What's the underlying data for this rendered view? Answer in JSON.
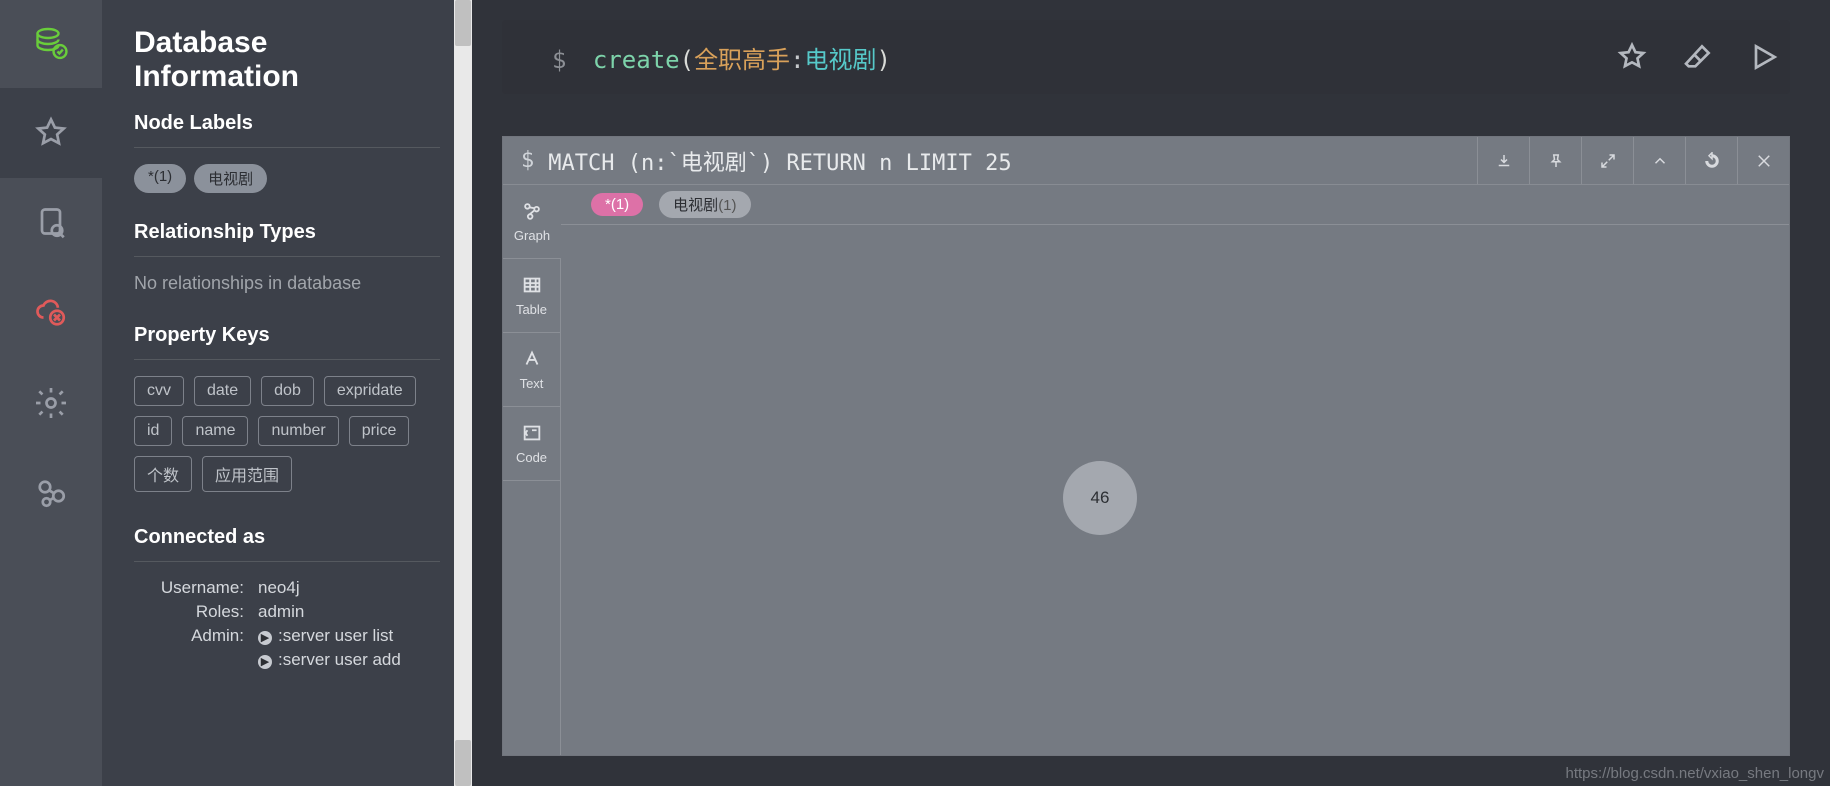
{
  "rail": {
    "items": [
      "database",
      "favorites",
      "documents",
      "about",
      "settings",
      "cloud"
    ]
  },
  "drawer": {
    "title": "Database Information",
    "nodeLabelsHeading": "Node Labels",
    "nodeLabels": [
      "*(1)",
      "电视剧"
    ],
    "relHeading": "Relationship Types",
    "relMessage": "No relationships in database",
    "propHeading": "Property Keys",
    "propertyKeys": [
      "cvv",
      "date",
      "dob",
      "expridate",
      "id",
      "name",
      "number",
      "price",
      "个数",
      "应用范围"
    ],
    "connHeading": "Connected as",
    "conn": {
      "usernameLabel": "Username:",
      "username": "neo4j",
      "rolesLabel": "Roles:",
      "roles": "admin",
      "adminLabel": "Admin:",
      "cmd1": ":server user list",
      "cmd2": ":server user add"
    }
  },
  "editor": {
    "prompt": "$",
    "kw": "create",
    "openParen": "(",
    "arg1": "全职高手",
    "colon": ":",
    "arg2": "电视剧",
    "closeParen": ")"
  },
  "result": {
    "prompt": "$",
    "query": "MATCH (n:`电视剧`) RETURN n LIMIT 25",
    "legend": [
      {
        "label": "*(1)",
        "style": "pink"
      },
      {
        "label": "电视剧",
        "count": "(1)",
        "style": "grey"
      }
    ],
    "viewtabs": [
      "Graph",
      "Table",
      "Text",
      "Code"
    ],
    "nodeLabel": "46"
  },
  "watermark": "https://blog.csdn.net/vxiao_shen_longv"
}
